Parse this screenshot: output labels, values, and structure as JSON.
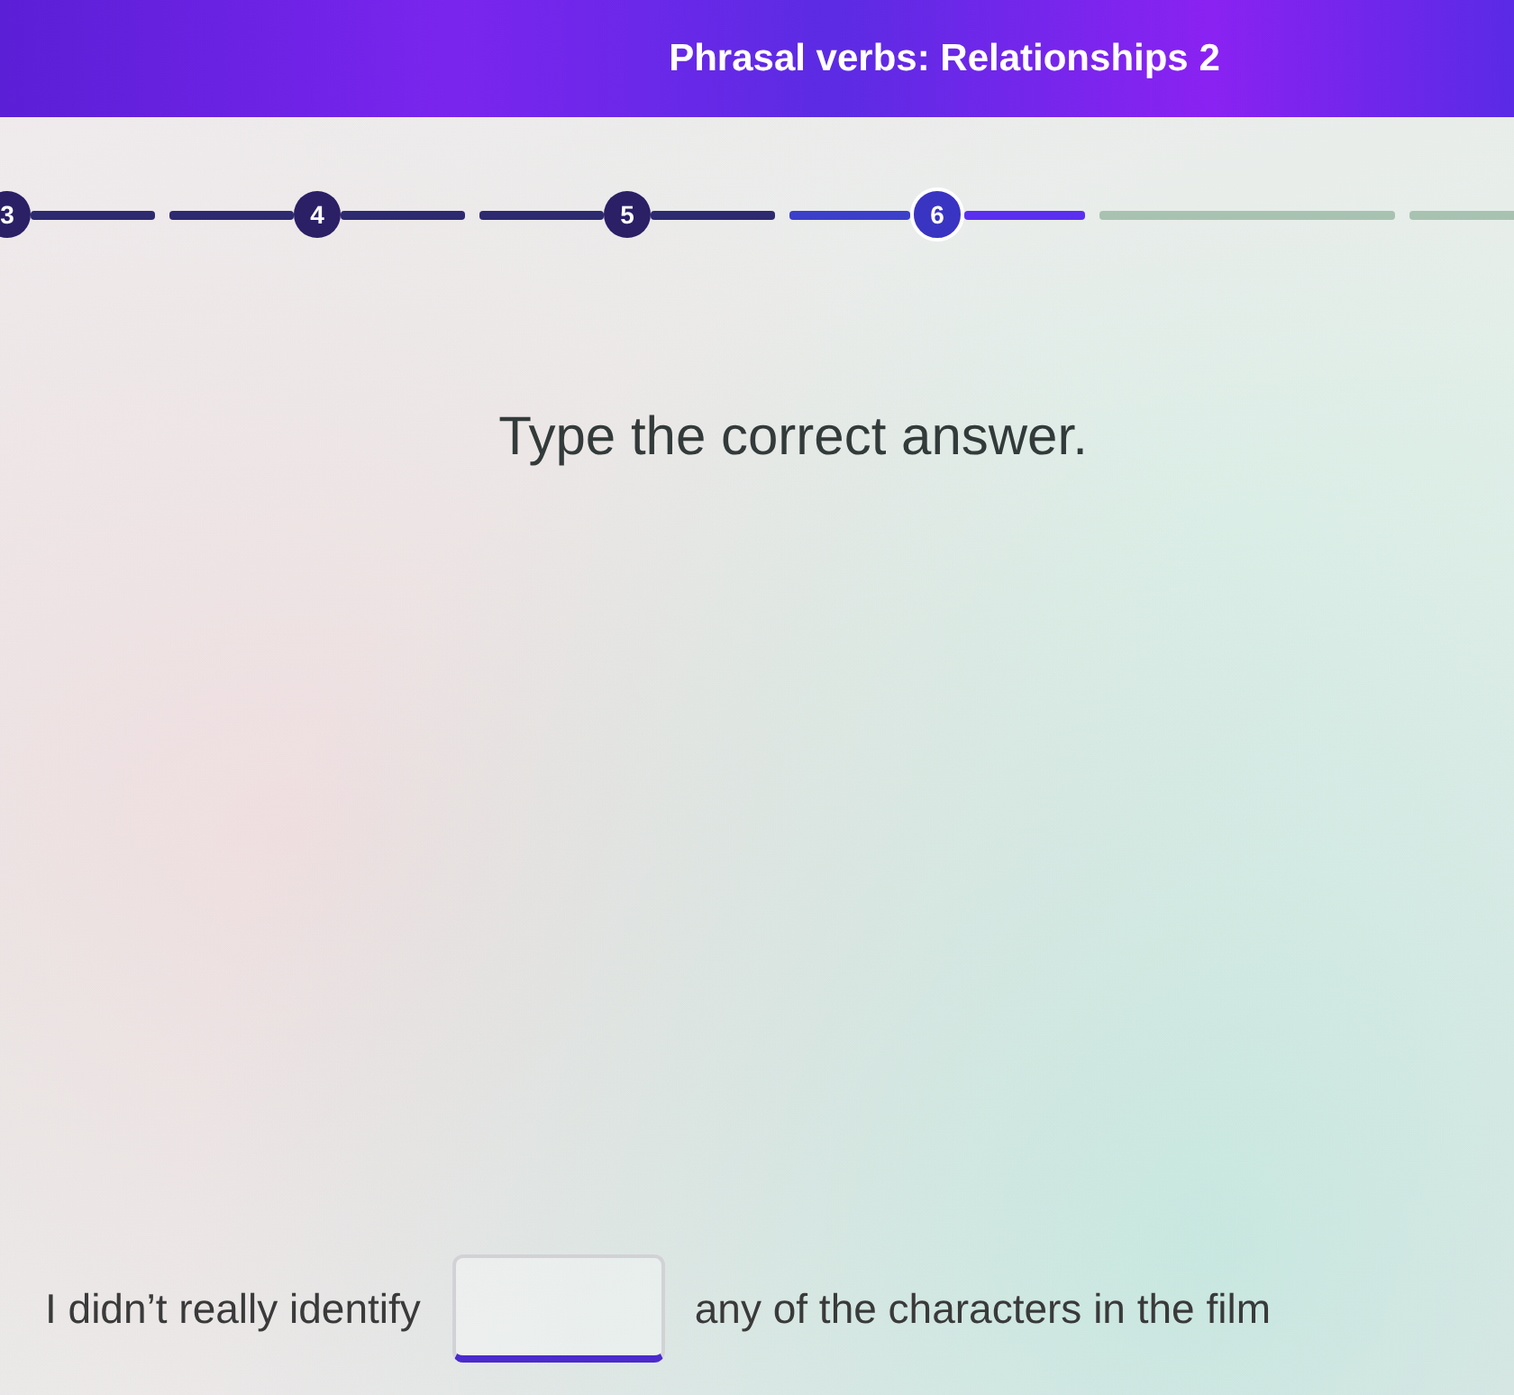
{
  "header": {
    "title": "Phrasal verbs: Relationships 2"
  },
  "progress": {
    "steps": [
      {
        "label": "3",
        "completed": true,
        "current": false
      },
      {
        "label": "4",
        "completed": true,
        "current": false
      },
      {
        "label": "5",
        "completed": true,
        "current": false
      },
      {
        "label": "6",
        "completed": false,
        "current": true
      },
      {
        "completed": false,
        "current": false
      },
      {
        "completed": false,
        "current": false
      }
    ]
  },
  "instruction": "Type the correct answer.",
  "question": {
    "before": "I didn’t really identify",
    "after": "any of the characters in the film"
  }
}
